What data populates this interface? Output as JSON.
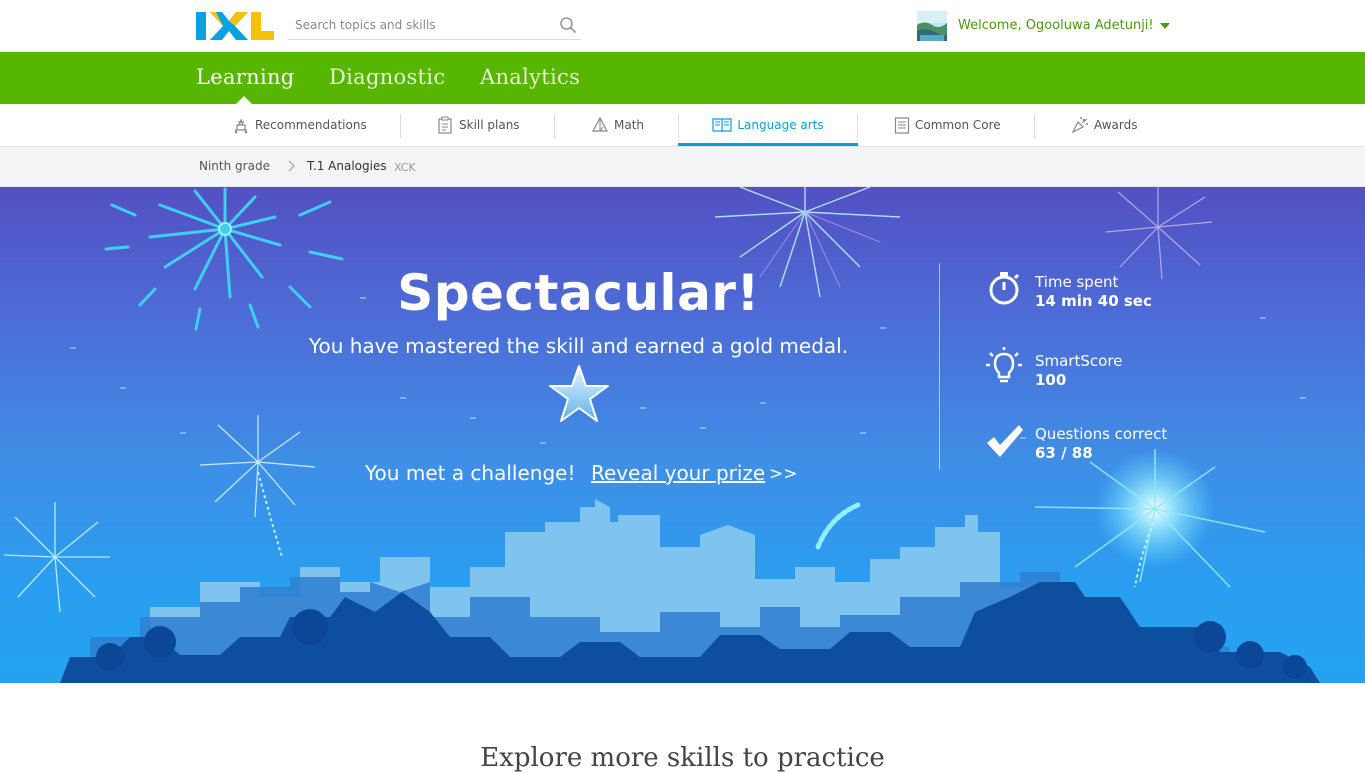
{
  "header": {
    "logo_text": "IXL",
    "search_placeholder": "Search topics and skills",
    "welcome": "Welcome, Ogooluwa Adetunji!"
  },
  "main_nav": [
    {
      "label": "Learning",
      "active": true
    },
    {
      "label": "Diagnostic",
      "active": false
    },
    {
      "label": "Analytics",
      "active": false
    }
  ],
  "sub_nav": [
    {
      "label": "Recommendations",
      "icon": "recommendations-icon"
    },
    {
      "label": "Skill plans",
      "icon": "skill-plans-icon"
    },
    {
      "label": "Math",
      "icon": "math-icon"
    },
    {
      "label": "Language arts",
      "icon": "language-arts-icon",
      "active": true
    },
    {
      "label": "Common Core",
      "icon": "common-core-icon"
    },
    {
      "label": "Awards",
      "icon": "awards-icon"
    }
  ],
  "breadcrumb": {
    "grade": "Ninth grade",
    "skill": "T.1 Analogies",
    "code": "XCK"
  },
  "result": {
    "title": "Spectacular!",
    "subtitle": "You have mastered the skill and earned a gold medal.",
    "challenge_text": "You met a challenge!",
    "prize_link": "Reveal your prize",
    "prize_arrow": ">>"
  },
  "stats": [
    {
      "label": "Time spent",
      "value": "14 min 40 sec",
      "icon": "stopwatch-icon"
    },
    {
      "label": "SmartScore",
      "value": "100",
      "icon": "lightbulb-icon"
    },
    {
      "label": "Questions correct",
      "value": "63 / 88",
      "icon": "checkmark-icon"
    }
  ],
  "explore_heading": "Explore more skills to practice",
  "colors": {
    "brand_green": "#56b600",
    "accent_blue": "#0a9fdc",
    "welcome_green": "#4a9a0a"
  }
}
